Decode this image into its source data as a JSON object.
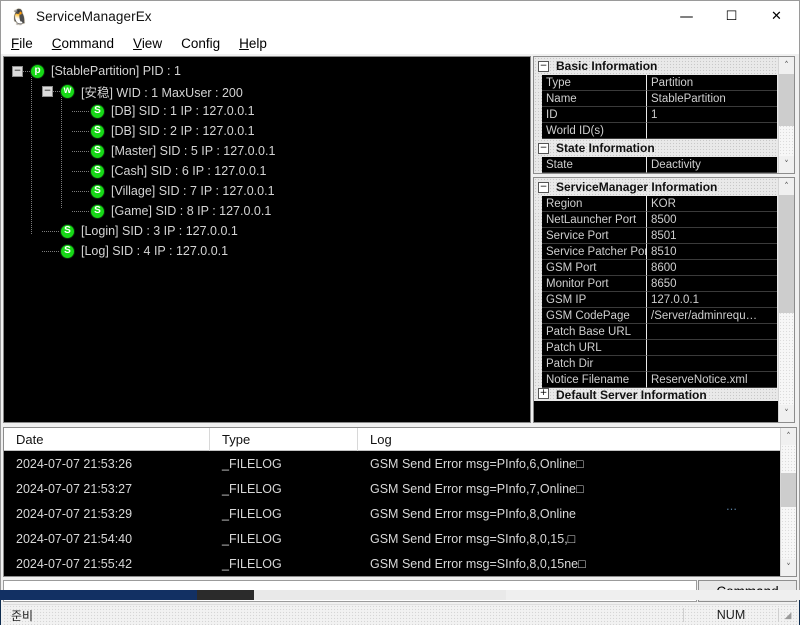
{
  "window": {
    "title": "ServiceManagerEx",
    "icon": "app-icon",
    "controls": {
      "minimize": "—",
      "maximize": "☐",
      "close": "✕"
    }
  },
  "menu": [
    {
      "name": "file",
      "accel": "F",
      "rest": "ile"
    },
    {
      "name": "command",
      "accel": "C",
      "rest": "ommand"
    },
    {
      "name": "view",
      "accel": "V",
      "rest": "iew"
    },
    {
      "name": "config",
      "accel": "",
      "rest": "Config"
    },
    {
      "name": "help",
      "accel": "H",
      "rest": "elp"
    }
  ],
  "tree": [
    {
      "depth": 0,
      "expander": "−",
      "icon": "p",
      "label": "[StablePartition] PID : 1"
    },
    {
      "depth": 1,
      "expander": "−",
      "icon": "w",
      "label": "[安稳] WID : 1 MaxUser : 200"
    },
    {
      "depth": 2,
      "expander": "",
      "icon": "S",
      "label": "[DB] SID : 1 IP : 127.0.0.1"
    },
    {
      "depth": 2,
      "expander": "",
      "icon": "S",
      "label": "[DB] SID : 2 IP : 127.0.0.1"
    },
    {
      "depth": 2,
      "expander": "",
      "icon": "S",
      "label": "[Master] SID : 5 IP : 127.0.0.1"
    },
    {
      "depth": 2,
      "expander": "",
      "icon": "S",
      "label": "[Cash] SID : 6 IP : 127.0.0.1"
    },
    {
      "depth": 2,
      "expander": "",
      "icon": "S",
      "label": "[Village] SID : 7 IP : 127.0.0.1"
    },
    {
      "depth": 2,
      "expander": "",
      "icon": "S",
      "label": "[Game] SID : 8 IP : 127.0.0.1"
    },
    {
      "depth": 1,
      "expander": "",
      "icon": "S",
      "label": "[Login] SID : 3 IP : 127.0.0.1"
    },
    {
      "depth": 1,
      "expander": "",
      "icon": "S",
      "label": "[Log] SID : 4 IP : 127.0.0.1"
    }
  ],
  "panels": {
    "basic": {
      "groups": [
        {
          "name": "basic-information",
          "title": "Basic Information",
          "box": "−",
          "rows": [
            {
              "key": "Type",
              "value": "Partition"
            },
            {
              "key": "Name",
              "value": "StablePartition"
            },
            {
              "key": "ID",
              "value": "1"
            },
            {
              "key": "World ID(s)",
              "value": ""
            }
          ]
        },
        {
          "name": "state-information",
          "title": "State Information",
          "box": "−",
          "rows": [
            {
              "key": "State",
              "value": "Deactivity"
            }
          ]
        }
      ],
      "scroll": {
        "up": "˄",
        "down": "˅"
      }
    },
    "servicemanager": {
      "group": {
        "name": "servicemanager-information",
        "title": "ServiceManager Information",
        "box": "−",
        "rows": [
          {
            "key": "Region",
            "value": "KOR"
          },
          {
            "key": "NetLauncher Port",
            "value": "8500"
          },
          {
            "key": "Service Port",
            "value": "8501"
          },
          {
            "key": "Service Patcher Port",
            "value": "8510"
          },
          {
            "key": "GSM Port",
            "value": "8600"
          },
          {
            "key": "Monitor Port",
            "value": "8650"
          },
          {
            "key": "GSM IP",
            "value": "127.0.0.1"
          },
          {
            "key": "GSM CodePage",
            "value": "/Server/adminrequ…"
          },
          {
            "key": "Patch Base URL",
            "value": ""
          },
          {
            "key": "Patch URL",
            "value": ""
          },
          {
            "key": "Patch Dir",
            "value": ""
          },
          {
            "key": "Notice Filename",
            "value": "ReserveNotice.xml"
          }
        ]
      },
      "collapsed_group": {
        "name": "default-server-information",
        "title": "Default Server Information",
        "box": "+"
      },
      "scroll": {
        "up": "˄",
        "down": "˅"
      }
    }
  },
  "log": {
    "columns": [
      {
        "name": "date",
        "label": "Date"
      },
      {
        "name": "type",
        "label": "Type"
      },
      {
        "name": "log",
        "label": "Log"
      }
    ],
    "rows": [
      {
        "date": "2024-07-07 21:53:26",
        "type": "_FILELOG",
        "log": "GSM Send Error msg=PInfo,6,Online□"
      },
      {
        "date": "2024-07-07 21:53:27",
        "type": "_FILELOG",
        "log": "GSM Send Error msg=PInfo,7,Online□"
      },
      {
        "date": "2024-07-07 21:53:29",
        "type": "_FILELOG",
        "log": "GSM Send Error msg=PInfo,8,Online"
      },
      {
        "date": "2024-07-07 21:54:40",
        "type": "_FILELOG",
        "log": "GSM Send Error msg=SInfo,8,0,15,□"
      },
      {
        "date": "2024-07-07 21:55:42",
        "type": "_FILELOG",
        "log": "GSM Send Error msg=SInfo,8,0,15ne□"
      }
    ],
    "artifact": "…",
    "scroll": {
      "up": "˄",
      "down": "˅"
    }
  },
  "command": {
    "input_value": "",
    "input_placeholder": "",
    "button_label": "Command"
  },
  "status": {
    "text": "준비",
    "num": "NUM",
    "grip": "◢"
  },
  "colors": {
    "node_green": "#16da16",
    "panel_black": "#000000",
    "text_gray": "#d4d4d4",
    "window_chrome": "#f0f0f0"
  }
}
